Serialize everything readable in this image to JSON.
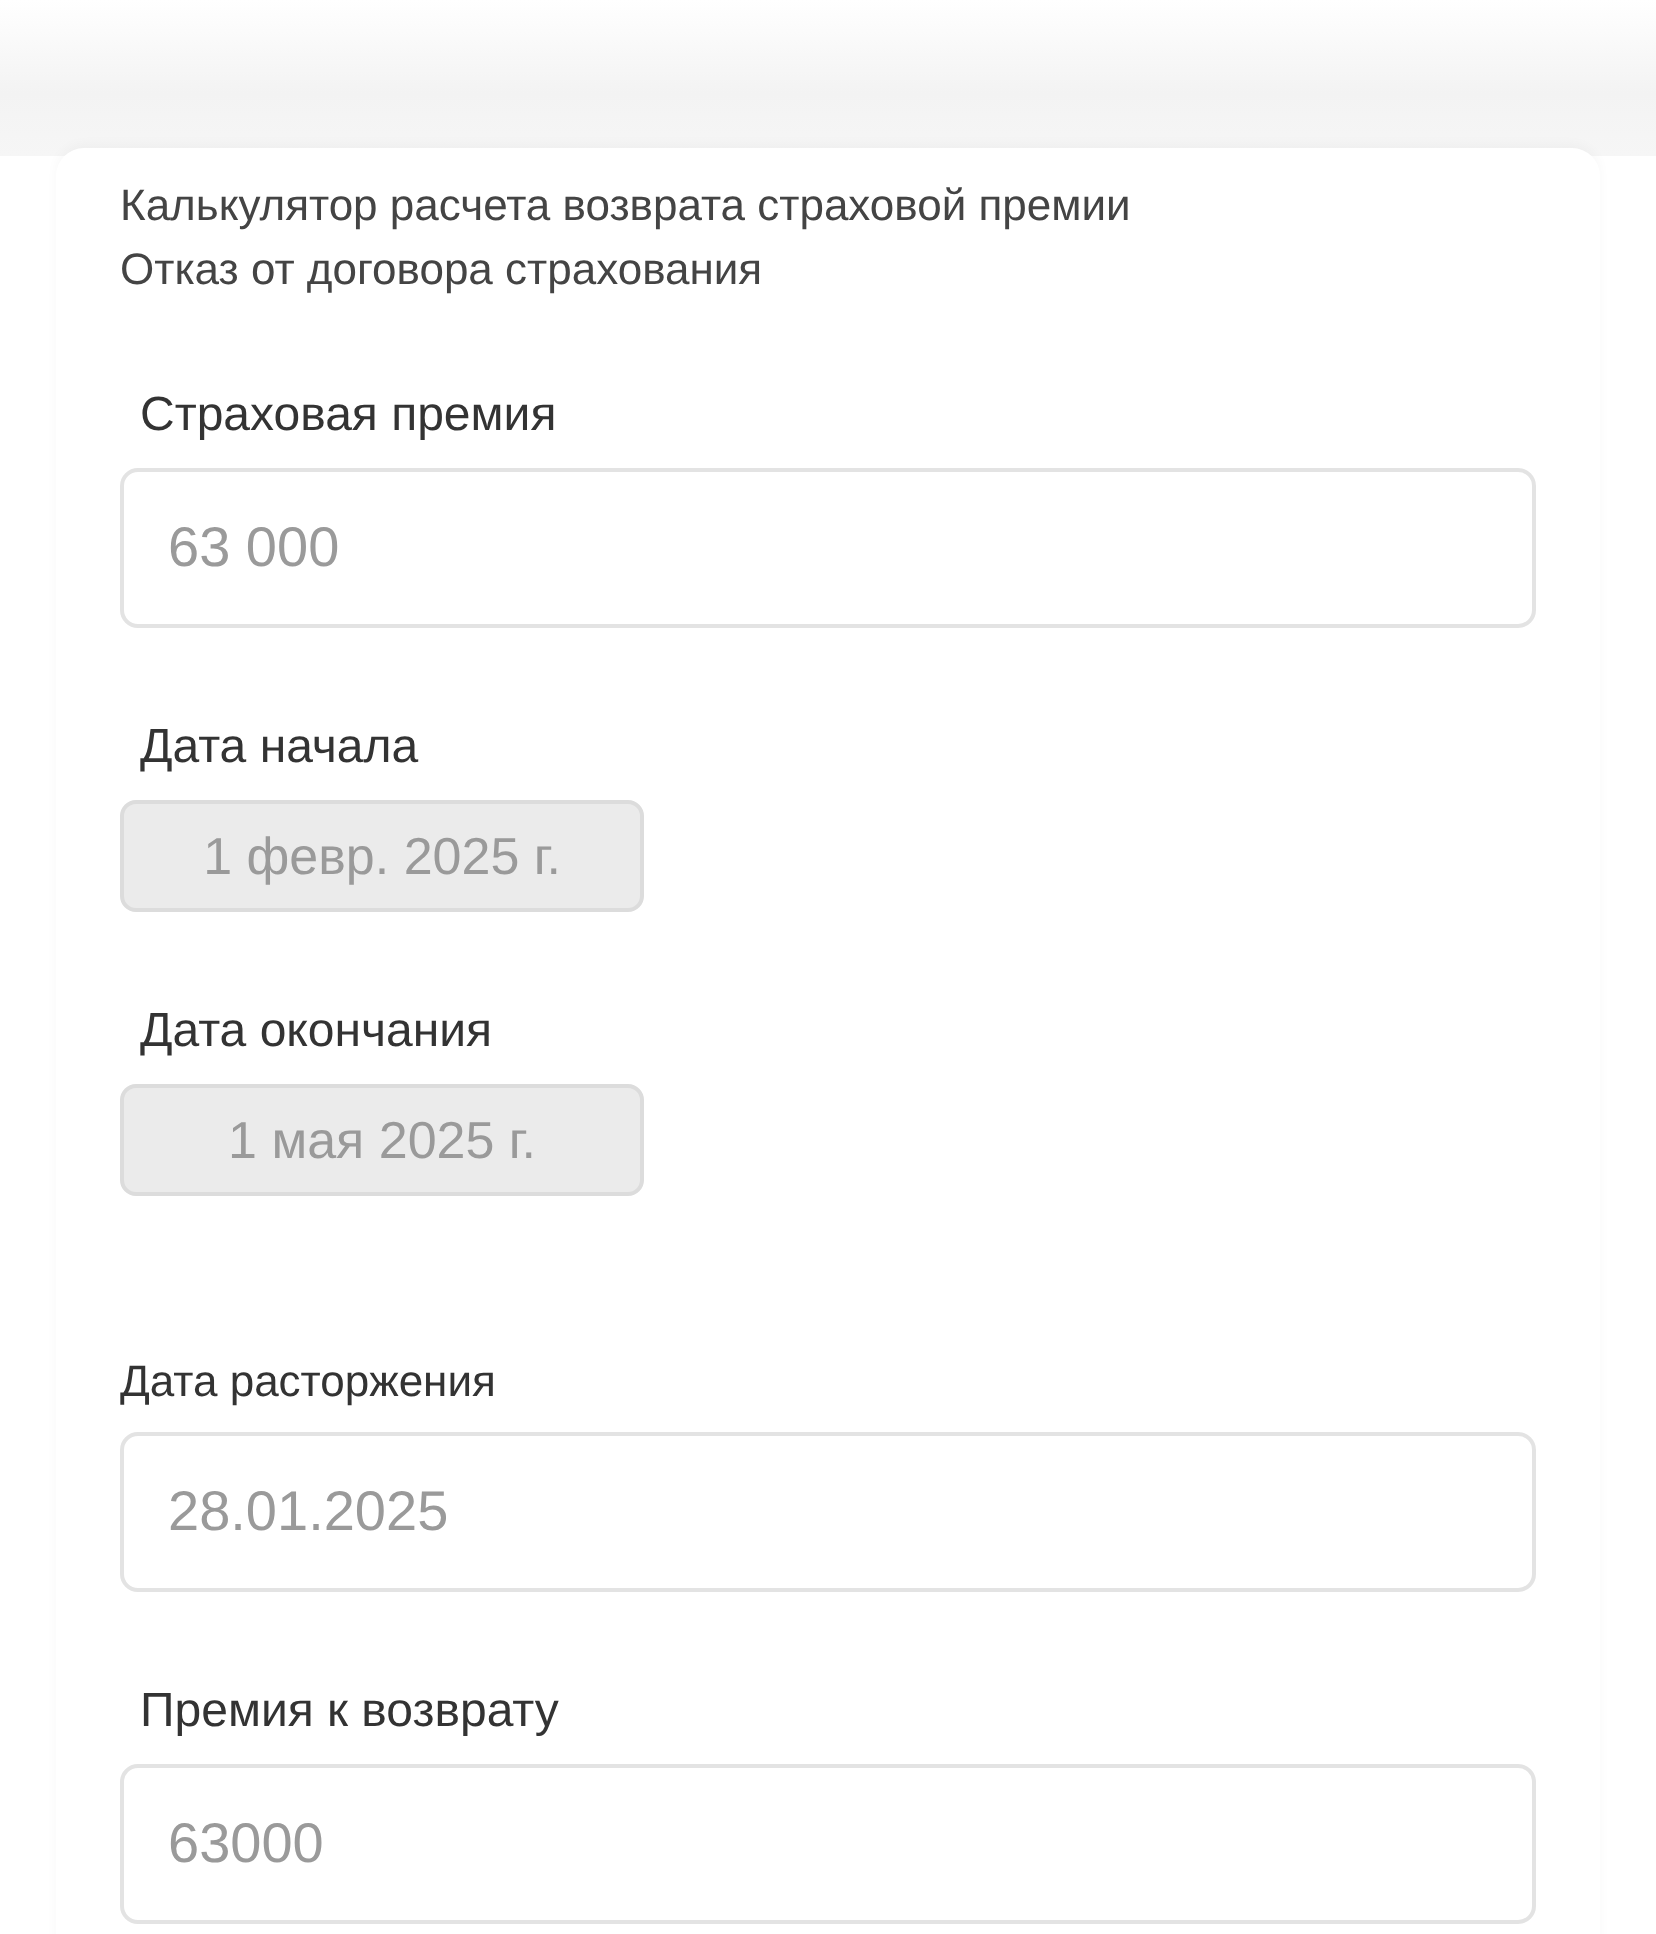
{
  "header": [
    "Калькулятор расчета возврата страховой премии",
    "Отказ от договора страхования"
  ],
  "fields": [
    {
      "kind": "input",
      "label": "Страховая премия",
      "value": "63 000"
    },
    {
      "kind": "date",
      "label": "Дата начала",
      "value": "1 февр. 2025 г."
    },
    {
      "kind": "date",
      "label": "Дата окончания",
      "value": "1 мая 2025 г."
    },
    {
      "kind": "input",
      "label": "Дата расторжения",
      "value": "28.01.2025"
    },
    {
      "kind": "input",
      "label": "Премия к возврату",
      "value": "63000"
    }
  ]
}
